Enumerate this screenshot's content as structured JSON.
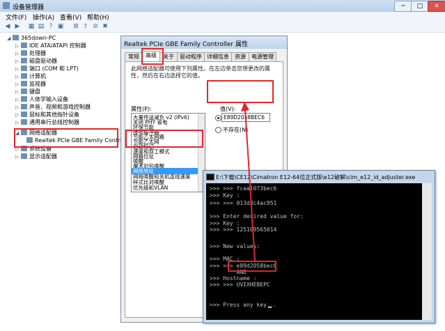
{
  "device_manager": {
    "title": "设备管理器",
    "menu": [
      "文件(F)",
      "操作(A)",
      "查看(V)",
      "帮助(H)"
    ],
    "tree": {
      "root": "365down-PC",
      "items": [
        "IDE ATA/ATAPI 控制器",
        "处理器",
        "磁盘驱动器",
        "端口 (COM 和 LPT)",
        "计算机",
        "监视器",
        "键盘",
        "人体学输入设备",
        "声音、视频和游戏控制器",
        "鼠标和其他指针设备",
        "通用串行总线控制器",
        "网络适配器",
        "Realtek PCIe GBE Family Controller",
        "系统设备",
        "显示适配器"
      ]
    }
  },
  "properties_dialog": {
    "title": "Realtek PCIe GBE Family Controller 属性",
    "tabs": [
      "常规",
      "高级",
      "关于",
      "驱动程序",
      "详细信息",
      "资源",
      "电源管理"
    ],
    "active_tab": "高级",
    "description": "此网络适配器可使用下列属性。在左边单击您想更改的属性，然后在右边选择它的值。",
    "property_label": "属性(P):",
    "properties": [
      "大量传送减负 v2 (IPv6)",
      "关闭 PHY 省电",
      "环保节能",
      "接收缓冲器",
      "节能乙太网路",
      "节能乙太网",
      "启动标记",
      "速度和双工模式",
      "网路位址",
      "唤醒",
      "魔术封包唤醒",
      "网络地址",
      "网络唤醒和关机连线速度",
      "样式比对唤醒",
      "优先级和VLAN"
    ],
    "selected_property": "网络地址",
    "value_label": "值(V):",
    "value": "E89D2058BEC6",
    "not_present_label": "不存在(N)"
  },
  "console": {
    "title": "E:\\下载\\CE12\\Cimatron E12-64位正式版\\e12破解\\cim_e12_id_adjuster.exe",
    "lines": [
      ">>> >>> fcaa1073bec6",
      ">>> Key :",
      ">>> >>> 013d3c4ac951",
      "",
      ">>> Enter desired value for:",
      ">>> Key :",
      ">>> >>> 125109565014",
      "",
      "",
      ">>> New values:",
      "",
      ">>> MAC :",
      ">>> >>> e89d2058bec6",
      "        AND",
      ">>> Hostname :",
      ">>> >>> UVIXHEBEPC",
      "",
      "",
      ">>> Press any key..."
    ]
  },
  "colors": {
    "annotation_red": "#e0262c",
    "selection_blue": "#3399ff",
    "console_bg": "#000000"
  }
}
